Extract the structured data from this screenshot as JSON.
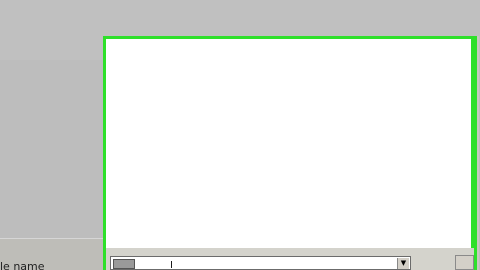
{
  "dialog": {
    "filename_label": "le name",
    "filename_value": "",
    "combo_arrow": "▼",
    "text_cursor": "I"
  },
  "colors": {
    "highlight": "#2ee02a",
    "background": "#bdbdbd",
    "list_background": "#ffffff"
  },
  "icons": {
    "combo_icon": "drive-icon",
    "combo_arrow": "dropdown-arrow-icon"
  }
}
